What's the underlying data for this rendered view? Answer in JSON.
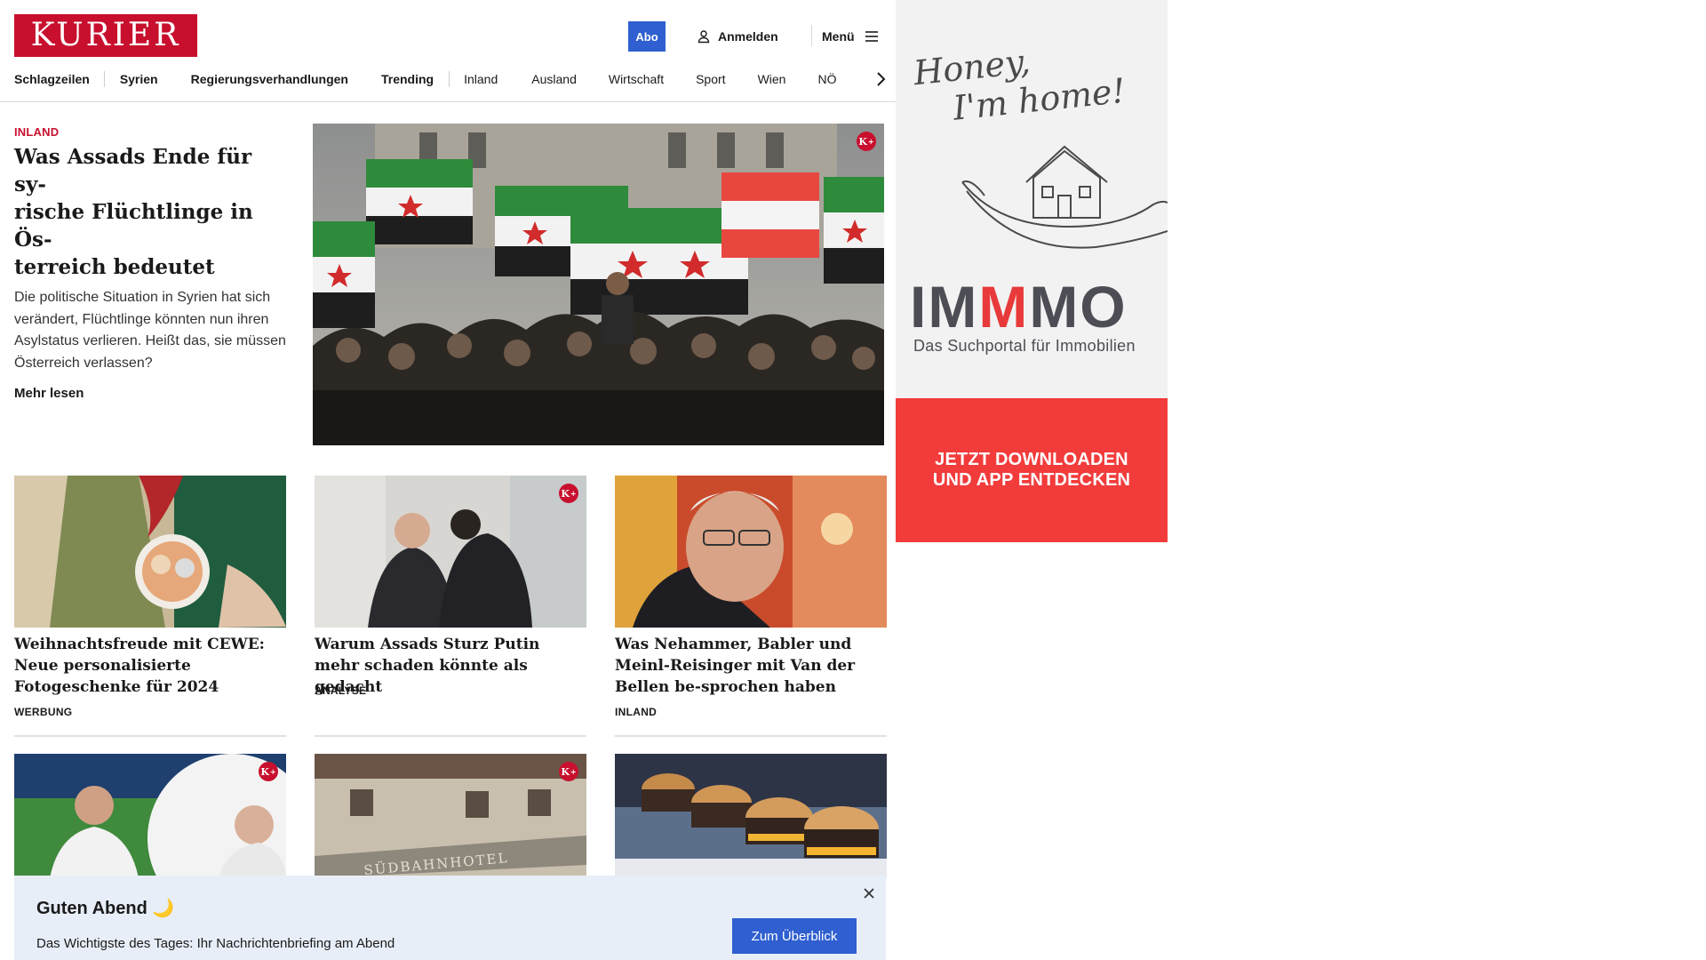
{
  "brand": {
    "logo_text": "KURIER",
    "accent": "#c8102e",
    "button_blue": "#2f5fd0"
  },
  "header": {
    "abo_label": "Abo",
    "login_label": "Anmelden",
    "login_icon": "user-icon",
    "menu_label": "Menü",
    "menu_icon": "hamburger-icon"
  },
  "nav": {
    "items": [
      "Schlagzeilen",
      "Syrien",
      "Regierungsverhandlungen",
      "Trending",
      "Inland",
      "Ausland",
      "Wirtschaft",
      "Sport",
      "Wien",
      "NÖ"
    ],
    "more_icon": "chevron-right-icon"
  },
  "hero": {
    "kicker": "INLAND",
    "title": "Was Assads Ende für sy-rische Flüchtlinge in Ös-terreich bedeutet",
    "title_lines": [
      "Was Assads Ende für sy-",
      "rische Flüchtlinge in Ös-",
      "terreich bedeutet"
    ],
    "teaser": "Die politische Situation in Syrien hat sich verändert, Flüchtlinge könnten nun ihren Asylstatus verlieren. Heißt das, sie müssen Österreich verlassen?",
    "more_label": "Mehr lesen",
    "image": "syrian-opposition-flags-crowd-photo",
    "premium_badge": "K+"
  },
  "cards_row1": [
    {
      "title": "Weihnachtsfreude mit CEWE: Neue personalisierte Fotogeschenke für 2024",
      "kicker": "WERBUNG",
      "image": "christmas-photo-ornament-photo",
      "premium": false
    },
    {
      "title": "Warum Assads Sturz Putin mehr schaden könnte als gedacht",
      "kicker": "ANALYSE",
      "image": "putin-assad-embrace-photo",
      "premium": true
    },
    {
      "title": "Was Nehammer, Babler und Meinl-Reisinger mit Van der Bellen be-sprochen haben",
      "kicker": "INLAND",
      "image": "van-der-bellen-portrait-photo",
      "premium": false
    }
  ],
  "cards_row2": [
    {
      "image": "football-coach-rangnick-photo",
      "premium": true
    },
    {
      "image": "suedbahnhotel-facade-photo",
      "premium": true,
      "visible_sign": "SÜDBAHNHOTEL"
    },
    {
      "image": "burger-sliders-photo",
      "premium": false
    }
  ],
  "ad": {
    "script_line1": "Honey,",
    "script_line2": "I'm home!",
    "brand_left": "IM",
    "brand_mid": "M",
    "brand_right": "MO",
    "subtitle": "Das Suchportal für Immobilien",
    "cta_line1": "JETZT DOWNLOADEN",
    "cta_line2": "UND APP ENTDECKEN",
    "accent": "#f23b3b"
  },
  "briefing": {
    "title": "Guten Abend 🌙",
    "text": "Das Wichtigste des Tages: Ihr Nachrichtenbriefing am Abend",
    "button_label": "Zum Überblick",
    "close_icon": "close-icon"
  }
}
